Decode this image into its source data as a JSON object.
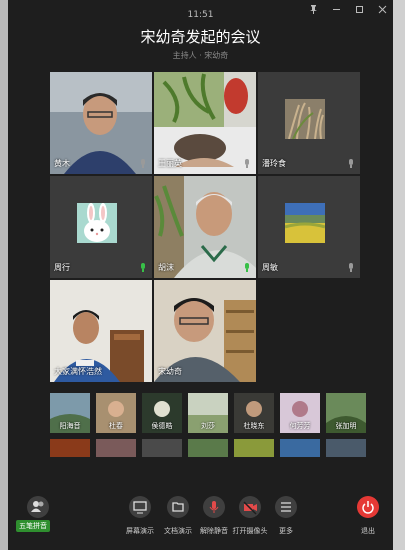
{
  "window": {
    "time": "11:51",
    "title": "宋幼奇发起的会议",
    "host_line": "主持人 · 宋幼奇",
    "controls": [
      "pin-icon",
      "minimize-icon",
      "maximize-icon",
      "close-icon"
    ]
  },
  "participants": [
    {
      "name": "黄木",
      "mic": "muted",
      "kind": "video"
    },
    {
      "name": "王丽英",
      "mic": "muted",
      "kind": "video"
    },
    {
      "name": "潘玲食",
      "mic": "muted",
      "kind": "avatar-grass"
    },
    {
      "name": "周行",
      "mic": "active",
      "kind": "avatar-rabbit"
    },
    {
      "name": "胡沫",
      "mic": "active",
      "kind": "video"
    },
    {
      "name": "周敏",
      "mic": "muted",
      "kind": "avatar-landscape"
    },
    {
      "name": "大家满怀浩然",
      "mic": "",
      "kind": "video"
    },
    {
      "name": "宋幼奇",
      "mic": "",
      "kind": "video"
    }
  ],
  "thumbnails_row1": [
    "阳海音",
    "杜春",
    "侯德皓",
    "刘莎",
    "杜晓东",
    "何芳芳",
    "张加明"
  ],
  "thumbnails_row2": [
    "",
    "",
    "",
    "",
    "",
    "",
    ""
  ],
  "toolbar": {
    "participants": "",
    "share_screen": "屏幕演示",
    "share_doc": "文档演示",
    "unmute": "解除静音",
    "camera": "打开摄像头",
    "more": "更多",
    "leave": "退出"
  },
  "ime": "五笔拼音",
  "colors": {
    "mic_active": "#38c048",
    "mic_muted": "#9a9a9a",
    "leave": "#e53935",
    "bg": "#1e1e1e"
  }
}
